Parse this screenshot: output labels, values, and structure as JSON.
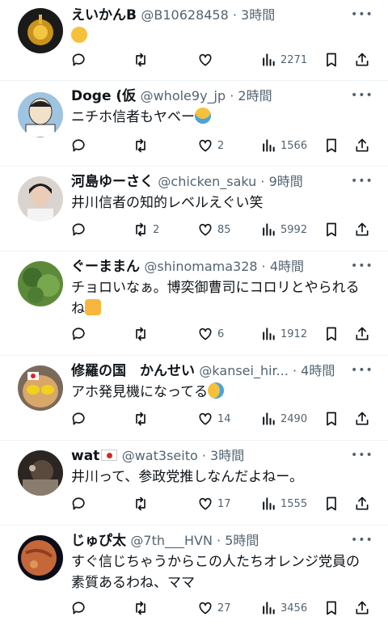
{
  "tweets": [
    {
      "name": "えいかんB",
      "handle": "@B10628458 · 3時間",
      "text": "",
      "emoji": "shushing-face",
      "replies": "",
      "retweets": "",
      "likes": "",
      "views": "2271"
    },
    {
      "name": "Doge (仮",
      "handle": "@whole9y_jp · 2時間",
      "text": "ニチホ信者もヤベー",
      "emoji": "tears-of-joy",
      "replies": "",
      "retweets": "",
      "likes": "2",
      "views": "1566"
    },
    {
      "name": "河島ゆーさく",
      "handle": "@chicken_saku · 9時間",
      "text": "井川信者の知的レベルえぐい笑",
      "emoji": "",
      "replies": "",
      "retweets": "2",
      "likes": "85",
      "views": "5992"
    },
    {
      "name": "ぐーままん",
      "handle": "@shinomama328 · 4時間",
      "text": "チョロいなぁ。博奕御曹司にコロリとやられるね",
      "emoji": "thumbs-up",
      "replies": "",
      "retweets": "",
      "likes": "6",
      "views": "1912"
    },
    {
      "name": "修羅の国　かんせい",
      "handle": "@kansei_hir... · 4時間",
      "text": "アホ発見機になってる",
      "emoji": "rolling-laughing",
      "replies": "",
      "retweets": "",
      "likes": "14",
      "views": "2490"
    },
    {
      "name": "wat",
      "handle": "@wat3seito · 3時間",
      "text": "井川って、参政党推しなんだよねー。",
      "emoji": "",
      "replies": "",
      "retweets": "",
      "likes": "17",
      "views": "1555"
    },
    {
      "name": "じゅぴ太",
      "handle": "@7th___HVN · 5時間",
      "text": "すぐ信じちゃうからこの人たちオレンジ党員の素質あるわね、ママ",
      "emoji": "",
      "replies": "",
      "retweets": "",
      "likes": "27",
      "views": "3456"
    }
  ],
  "icons": {
    "reply": "reply-icon",
    "retweet": "retweet-icon",
    "like": "heart-icon",
    "views": "views-icon",
    "bookmark": "bookmark-icon",
    "share": "share-icon",
    "more": "more-icon"
  },
  "colors": {
    "text": "#0f1419",
    "secondary": "#536471",
    "divider": "#eff3f4"
  }
}
